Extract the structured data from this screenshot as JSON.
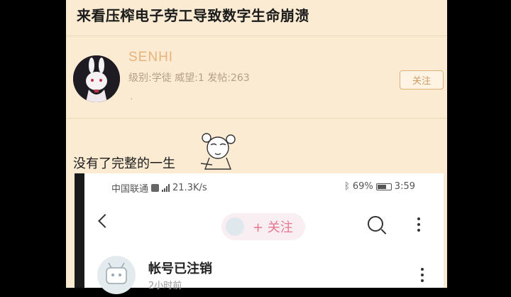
{
  "forum": {
    "title": "来看压榨电子劳工导致数字生命崩溃",
    "username": "SENHI",
    "user_info": "级别:学徒 威望:1 发帖:263",
    "user_extra": ".",
    "follow_label": "关注",
    "caption": "没有了完整的一生",
    "colors": {
      "background": "#fbebd2",
      "username": "#e8b27c",
      "follow_border": "#e2b177"
    }
  },
  "phone": {
    "status": {
      "carrier": "中国联通",
      "speed": "21.3K/s",
      "battery": "69%",
      "time": "3:59",
      "battery_level": 0.69
    },
    "header": {
      "follow_label": "+ 关注"
    },
    "account": {
      "name": "帐号已注销",
      "time": "2小时前"
    },
    "icons": [
      "back-icon",
      "search-icon",
      "more-icon",
      "bluetooth-icon",
      "battery-icon",
      "signal-icon"
    ]
  }
}
